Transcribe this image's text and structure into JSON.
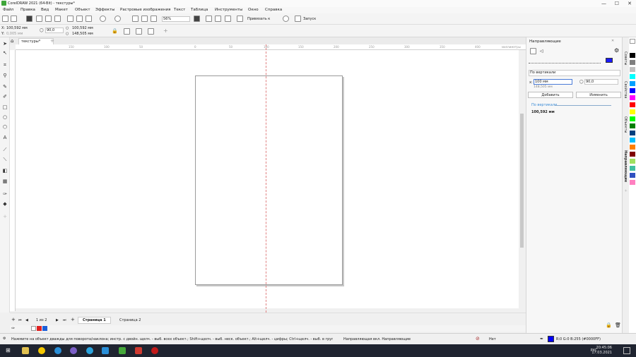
{
  "window": {
    "title": "CorelDRAW 2021 (64-Bit) - текстуры*",
    "min": "—",
    "max": "☐",
    "close": "✕"
  },
  "menu": [
    "Файл",
    "Правка",
    "Вид",
    "Макет",
    "Объект",
    "Эффекты",
    "Растровые изображения",
    "Текст",
    "Таблица",
    "Инструменты",
    "Окно",
    "Справка"
  ],
  "stdbar": {
    "zoom": "56%",
    "snap_label": "Привязать к",
    "launch_label": "Запуск"
  },
  "props": {
    "x": "100,592 мм",
    "y": "0,005 мм",
    "angle": "90,0",
    "pos1": "100,592 мм",
    "pos2": "148,505 мм"
  },
  "doc": {
    "tab": "текстуры*"
  },
  "hruler_ticks": [
    "150",
    "100",
    "50",
    "0",
    "50",
    "100",
    "150",
    "200",
    "250",
    "300",
    "350",
    "400",
    "миллиметры"
  ],
  "pagenav": {
    "counter": "1 из 2",
    "page1": "Страница 1",
    "page2": "Страница 2"
  },
  "status": {
    "hint": "Нажмите на объект дважды для поворота/наклона; инстр. с двойн. щелч. - выб. всех объект.; Shift+щелч. - выб. неск. объект.; Alt+щелч. - цифры; Ctrl+щелч. - выб. в группе",
    "object": "Направляющая вкл. Направляющие",
    "fill_none": "Нет",
    "outline": "R:0 G:0 B:255 (#0000FF)"
  },
  "dock": {
    "title": "Направляющие",
    "orientation": "По вертикали",
    "x_label": "x:",
    "x_value": "100 мм",
    "x_sub": "148,505 мм",
    "angle_value": "90,0",
    "add_button": "Добавить",
    "change_button": "Изменить",
    "list_header": "По вертикали",
    "list_item": "100,592 мм",
    "line_color": "#1a1aff"
  },
  "side_tabs": [
    "Советы",
    "Свойства",
    "Объекты",
    "Направляющие"
  ],
  "taskbar": {
    "lang": "РУС",
    "time": "20:45:06",
    "date": "17.03.2021"
  },
  "palette": [
    "#ffffff",
    "#000000",
    "#7f7f7f",
    "#bfbfbf",
    "#00ffff",
    "#00a0ff",
    "#0000ff",
    "#ff00ff",
    "#ff0000",
    "#ffff00",
    "#00ff00",
    "#007f00",
    "#003f7f",
    "#00bfff",
    "#ff7f00",
    "#7f0000",
    "#a0e060",
    "#40c0a0",
    "#3050c0",
    "#ff80c0"
  ]
}
